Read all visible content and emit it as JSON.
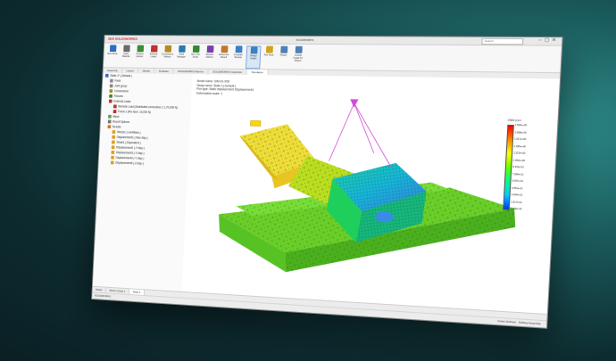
{
  "app": {
    "brand": "3DS SOLIDWORKS",
    "window_title": "SOLIDWORKS",
    "search_placeholder": "Search"
  },
  "ribbon": [
    {
      "label": "New Study",
      "color": "#2e6bbf"
    },
    {
      "label": "Apply Material",
      "color": "#6b6b6b"
    },
    {
      "label": "Fixtures Advisor",
      "color": "#3a8a3a"
    },
    {
      "label": "External Loads",
      "color": "#c03030"
    },
    {
      "label": "Connections Advisor",
      "color": "#b58a20"
    },
    {
      "label": "Shell Manager",
      "color": "#2a7ab0"
    },
    {
      "label": "Run This Study",
      "color": "#2e8c2e"
    },
    {
      "label": "Results Advisor",
      "color": "#7a3fa8"
    },
    {
      "label": "Deformed Result",
      "color": "#c0782a"
    },
    {
      "label": "Compare Results",
      "color": "#3d7fc4"
    },
    {
      "label": "Design Insight",
      "color": "#3d7fc4",
      "active": true
    },
    {
      "label": "Plot Tools",
      "color": "#d1a21f"
    },
    {
      "label": "Report",
      "color": "#4f7fb5"
    },
    {
      "label": "Include Image for Report",
      "color": "#4f7fb5"
    }
  ],
  "tabs": [
    "Assembly",
    "Layout",
    "Sketch",
    "Evaluate",
    "SOLIDWORKS Add-Ins",
    "SOLIDWORKS Inspection",
    "Simulation"
  ],
  "active_tab": "Simulation",
  "tree": [
    {
      "label": "Static 1* (-Default-)",
      "indent": 0,
      "color": "#3a6fb8"
    },
    {
      "label": "Parts",
      "indent": 1,
      "color": "#8a8a8a"
    },
    {
      "label": "Joint group",
      "indent": 1,
      "color": "#8a8a8a"
    },
    {
      "label": "Connections",
      "indent": 1,
      "color": "#b58a20"
    },
    {
      "label": "Fixtures",
      "indent": 1,
      "color": "#3a8a3a"
    },
    {
      "label": "External Loads",
      "indent": 1,
      "color": "#c03030"
    },
    {
      "label": "Remote Load (Distributed connection-1 1,70,000 N)",
      "indent": 2,
      "color": "#c03030"
    },
    {
      "label": "Force-1 (Per item: 10,000 N)",
      "indent": 2,
      "color": "#c03030"
    },
    {
      "label": "Mesh",
      "indent": 1,
      "color": "#5aa05a"
    },
    {
      "label": "Result Options",
      "indent": 1,
      "color": "#777777"
    },
    {
      "label": "Results",
      "indent": 1,
      "color": "#d17a20"
    },
    {
      "label": "Stress1 (-vonMises-)",
      "indent": 2,
      "color": "#e0a020"
    },
    {
      "label": "Displacement1 (-Res disp-)",
      "indent": 2,
      "color": "#e0a020"
    },
    {
      "label": "Strain1 (-Equivalent-)",
      "indent": 2,
      "color": "#e0a020"
    },
    {
      "label": "Displacement2 (-Y disp-)",
      "indent": 2,
      "color": "#e0a020"
    },
    {
      "label": "Displacement3 (-X disp-)",
      "indent": 2,
      "color": "#e0a020"
    },
    {
      "label": "Displacement4 (-Y disp-)",
      "indent": 2,
      "color": "#e0a020"
    },
    {
      "label": "Displacement5 (-Z disp-)",
      "indent": 2,
      "color": "#e0a020"
    }
  ],
  "info": {
    "line1": "Model name: SIM-01-X08",
    "line2": "Study name: Static 1(-Default-)",
    "line3": "Plot type: Static displacement Displacement1",
    "line4": "Deformation scale: 1"
  },
  "legend": {
    "unit": "URES (mm)",
    "values": [
      "1.820e+00",
      "1.668e+00",
      "1.517e+00",
      "1.365e+00",
      "1.213e+00",
      "1.062e+00",
      "9.101e-01",
      "7.584e-01",
      "6.067e-01",
      "4.551e-01",
      "3.034e-01",
      "1.517e-01",
      "1.000e-30"
    ]
  },
  "bottom_tabs": [
    "Model",
    "Motion Study 1",
    "Static 1"
  ],
  "active_bottom_tab": "Static 1",
  "status": {
    "left": "SOLIDWORKS",
    "right1": "Under Defined",
    "right2": "Editing Assembly"
  },
  "colors": {
    "accent": "#d3202a",
    "mesh_green": "#6fd62a",
    "hot": "#ff3b00",
    "cold": "#2d4fd6"
  }
}
